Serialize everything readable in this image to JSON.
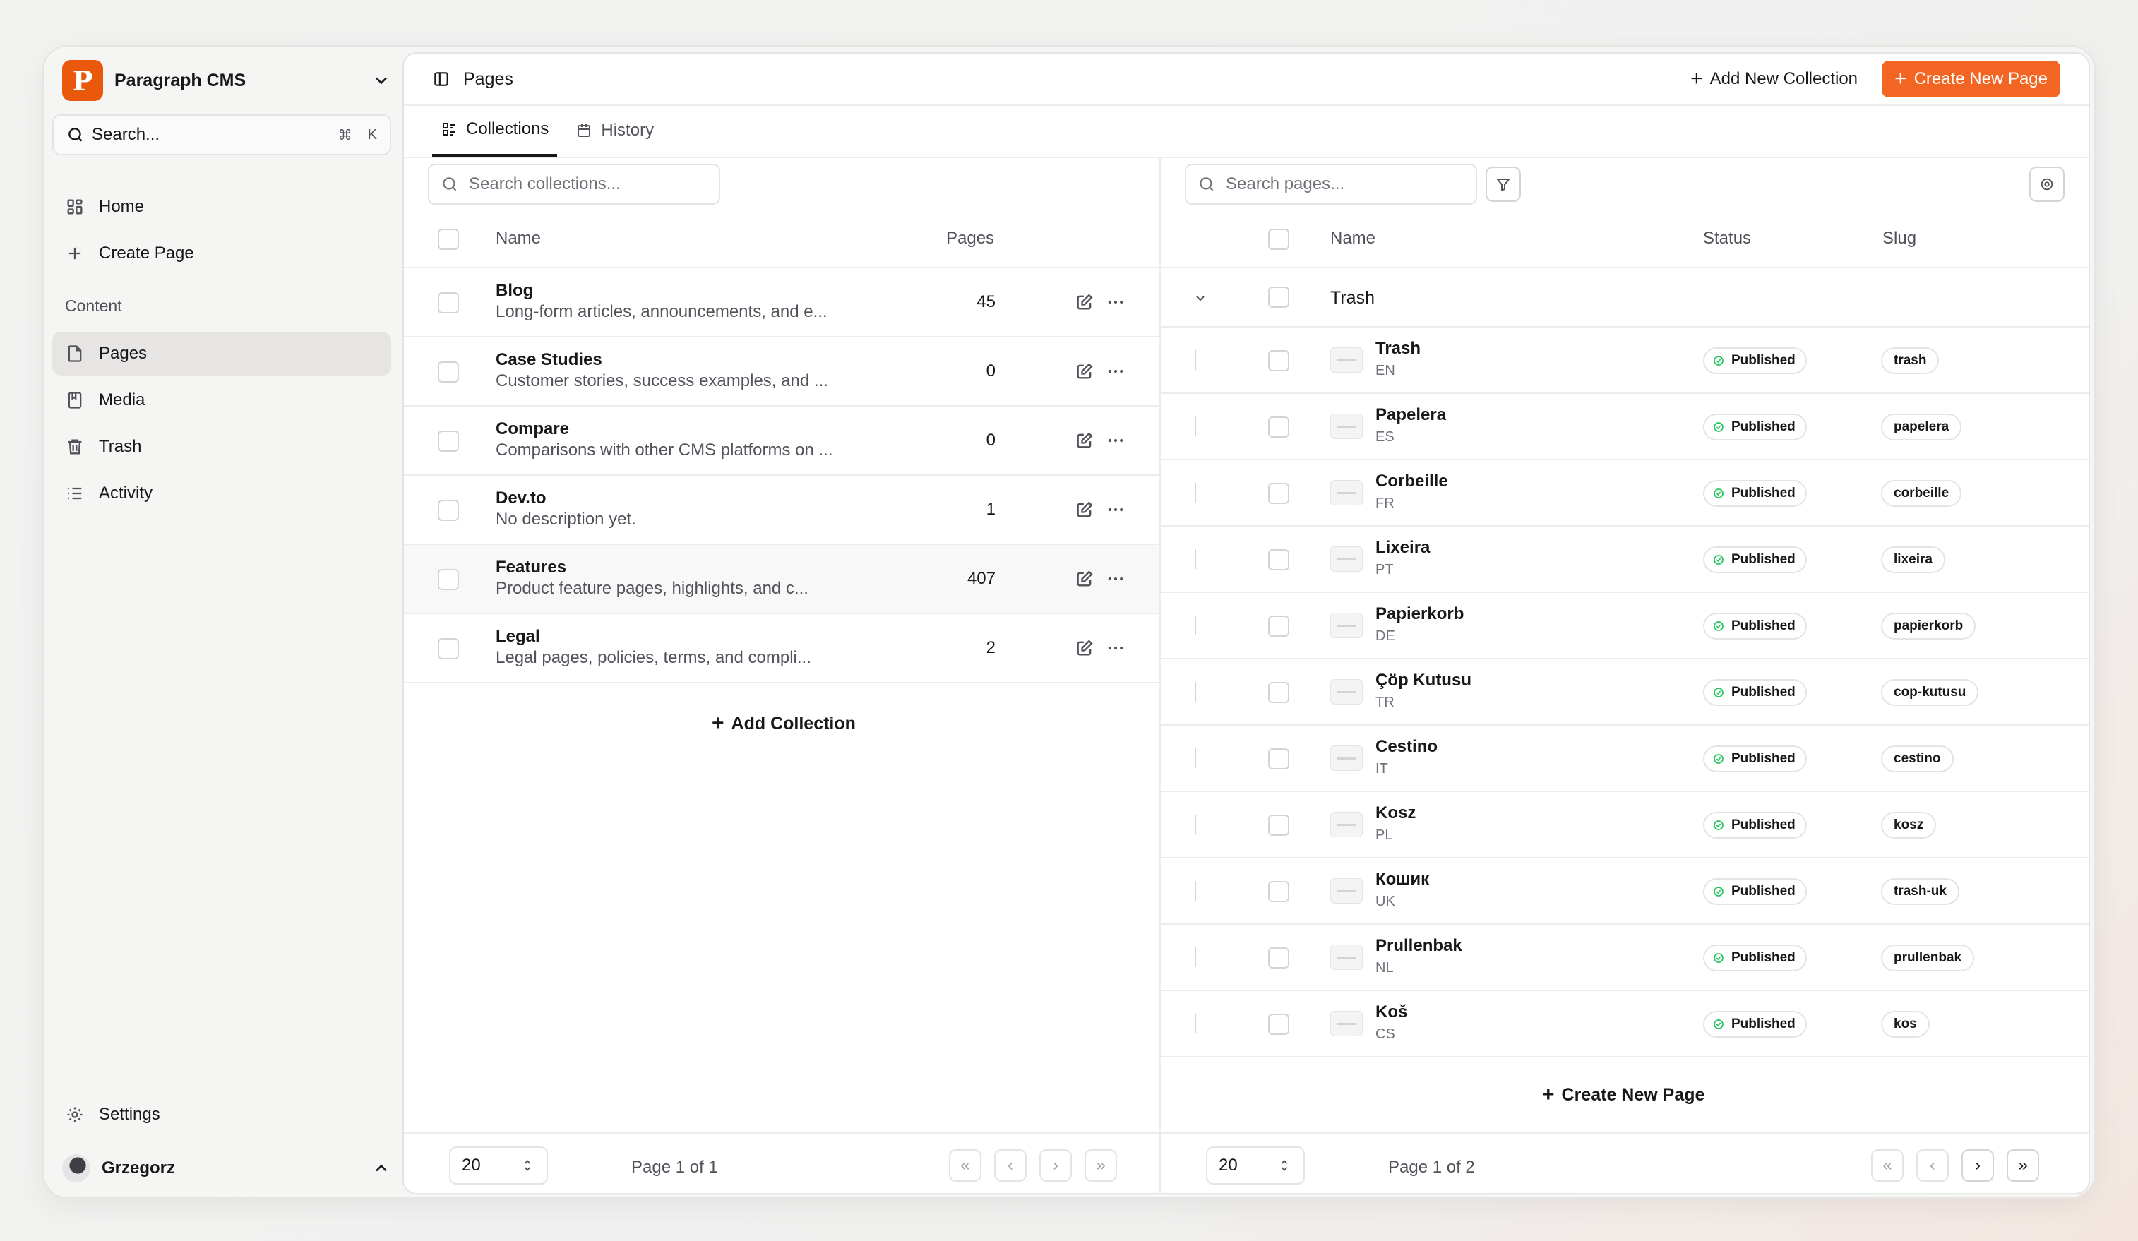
{
  "brand": {
    "name": "Paragraph CMS",
    "logo_letter": "P",
    "accent": "#f26522"
  },
  "sidebar": {
    "search_label": "Search...",
    "search_kbd": [
      "⌘",
      "K"
    ],
    "nav_top": [
      {
        "label": "Home",
        "icon": "grid-icon"
      },
      {
        "label": "Create Page",
        "icon": "plus-icon"
      }
    ],
    "section_label": "Content",
    "nav_content": [
      {
        "label": "Pages",
        "icon": "file-icon",
        "active": true
      },
      {
        "label": "Media",
        "icon": "book-icon"
      },
      {
        "label": "Trash",
        "icon": "trash-icon"
      },
      {
        "label": "Activity",
        "icon": "list-icon"
      }
    ],
    "settings_label": "Settings",
    "user_name": "Grzegorz"
  },
  "topbar": {
    "title": "Pages",
    "add_collection_label": "Add New Collection",
    "create_page_label": "Create New Page"
  },
  "tabs": [
    {
      "label": "Collections",
      "active": true
    },
    {
      "label": "History",
      "active": false
    }
  ],
  "collections": {
    "search_placeholder": "Search collections...",
    "headers": {
      "name": "Name",
      "pages": "Pages"
    },
    "rows": [
      {
        "name": "Blog",
        "description": "Long-form articles, announcements, and e...",
        "pages": "45"
      },
      {
        "name": "Case Studies",
        "description": "Customer stories, success examples, and ...",
        "pages": "0"
      },
      {
        "name": "Compare",
        "description": "Comparisons with other CMS platforms on ...",
        "pages": "0"
      },
      {
        "name": "Dev.to",
        "description": "No description yet.",
        "pages": "1"
      },
      {
        "name": "Features",
        "description": "Product feature pages, highlights, and c...",
        "pages": "407"
      },
      {
        "name": "Legal",
        "description": "Legal pages, policies, terms, and compli...",
        "pages": "2"
      }
    ],
    "add_label": "Add Collection",
    "footer": {
      "page_size": "20",
      "page_text": "Page 1 of 1"
    }
  },
  "pages": {
    "search_placeholder": "Search pages...",
    "headers": {
      "name": "Name",
      "status": "Status",
      "slug": "Slug"
    },
    "group_name": "Trash",
    "rows": [
      {
        "name": "Trash",
        "lang": "EN",
        "status": "Published",
        "slug": "trash"
      },
      {
        "name": "Papelera",
        "lang": "ES",
        "status": "Published",
        "slug": "papelera"
      },
      {
        "name": "Corbeille",
        "lang": "FR",
        "status": "Published",
        "slug": "corbeille"
      },
      {
        "name": "Lixeira",
        "lang": "PT",
        "status": "Published",
        "slug": "lixeira"
      },
      {
        "name": "Papierkorb",
        "lang": "DE",
        "status": "Published",
        "slug": "papierkorb"
      },
      {
        "name": "Çöp Kutusu",
        "lang": "TR",
        "status": "Published",
        "slug": "cop-kutusu"
      },
      {
        "name": "Cestino",
        "lang": "IT",
        "status": "Published",
        "slug": "cestino"
      },
      {
        "name": "Kosz",
        "lang": "PL",
        "status": "Published",
        "slug": "kosz"
      },
      {
        "name": "Кошик",
        "lang": "UK",
        "status": "Published",
        "slug": "trash-uk"
      },
      {
        "name": "Prullenbak",
        "lang": "NL",
        "status": "Published",
        "slug": "prullenbak"
      },
      {
        "name": "Koš",
        "lang": "CS",
        "status": "Published",
        "slug": "kos"
      }
    ],
    "create_label": "Create New Page",
    "footer": {
      "page_size": "20",
      "page_text": "Page 1 of 2"
    }
  }
}
